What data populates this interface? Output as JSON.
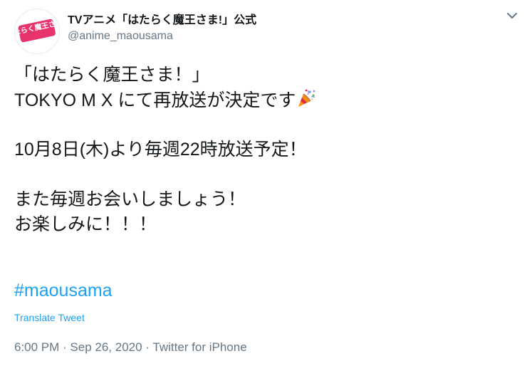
{
  "header": {
    "display_name": "TVアニメ「はたらく魔王さま!」公式",
    "handle": "@anime_maousama",
    "avatar_text": "はたらく魔王さま!",
    "chevron_icon": "chevron-down-icon"
  },
  "tweet": {
    "lines": [
      "「はたらく魔王さま！」",
      "TOKYO M X にて再放送が決定です",
      "",
      "10月8日(木)より毎週22時放送予定！",
      "",
      "また毎週お会いしましょう！",
      "お楽しみに！！！"
    ],
    "emoji_icon": "party-popper-icon",
    "hashtag": "#maousama",
    "translate_label": "Translate Tweet"
  },
  "meta": {
    "time": "6:00 PM",
    "separator1": " · ",
    "date": "Sep 26, 2020",
    "separator2": " · ",
    "source": "Twitter for iPhone"
  },
  "colors": {
    "link": "#1da1f2",
    "secondary_text": "#657786",
    "primary_text": "#14171a",
    "avatar_brand": "#e8336d"
  }
}
